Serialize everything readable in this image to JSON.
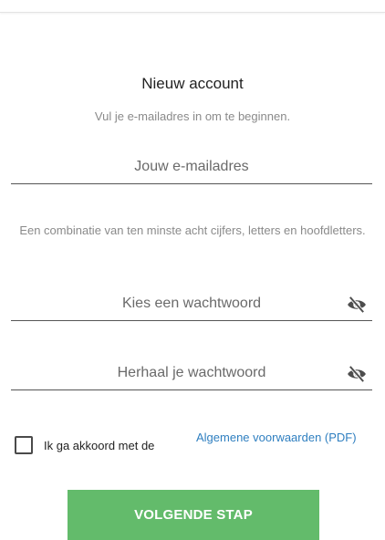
{
  "header": {
    "title": "Nieuw account",
    "subtitle": "Vul je e-mailadres in om te beginnen."
  },
  "email": {
    "placeholder": "Jouw e-mailadres"
  },
  "password_hint": "Een combinatie van ten minste acht cijfers, letters en hoofdletters.",
  "password": {
    "placeholder": "Kies een wachtwoord",
    "toggle_icon": "eye-off-icon"
  },
  "password_repeat": {
    "placeholder": "Herhaal je wachtwoord",
    "toggle_icon": "eye-off-icon"
  },
  "terms": {
    "checked": false,
    "label": "Ik ga akkoord met de",
    "link_text": "Algemene voorwaarden (PDF)"
  },
  "next_button": {
    "label": "VOLGENDE STAP",
    "color": "#63bb6b"
  },
  "colors": {
    "link": "#2f7fc0",
    "hint_text": "#8a8a8a"
  }
}
